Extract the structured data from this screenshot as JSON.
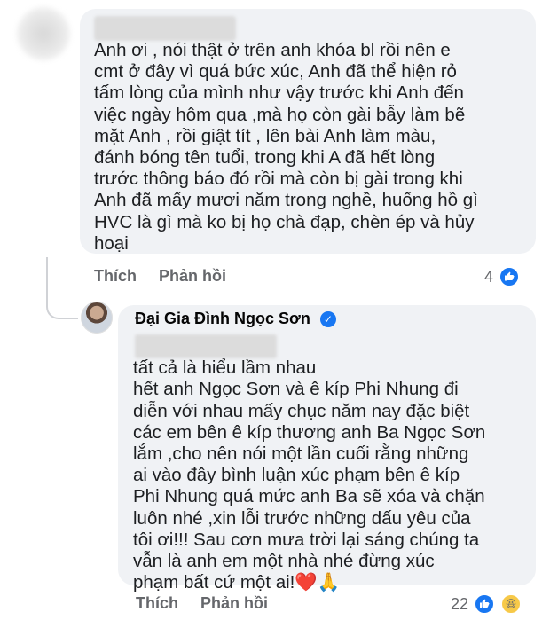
{
  "comment": {
    "text": "Anh ơi , nói thật ở trên anh khóa bl rồi nên e\ncmt ở đây vì quá bức xúc, Anh đã thể hiện rỏ\ntấm lòng của mình như vậy trước khi Anh đến\nviệc ngày hôm qua ,mà họ còn gài bẫy làm bẽ\nmặt Anh , rồi giật tít , lên bài Anh làm màu,\nđánh bóng tên tuổi, trong khi A đã hết lòng\ntrước thông báo đó rồi mà còn bị gài trong khi\nAnh đã mấy mươi năm trong nghề, huống hồ gì\nHVC  là gì mà ko bị họ chà đạp, chèn ép và hủy\nhoại",
    "actions": {
      "like": "Thích",
      "reply": "Phản hồi"
    },
    "reaction_count": "4"
  },
  "reply": {
    "author": "Đại Gia Đình Ngọc Sơn",
    "text": "                              tất cả là hiểu lầm nhau\nhết anh Ngọc Sơn và ê kíp Phi Nhung đi\ndiễn với nhau mấy chục năm nay đặc biệt\ncác em bên ê kíp thương anh Ba Ngọc Sơn\nlắm ,cho nên nói một lần cuối rằng những\nai vào đây bình luận xúc phạm bên ê kíp\nPhi Nhung quá mức anh Ba sẽ xóa và chặn\nluôn nhé ,xin lỗi trước những dấu yêu của\ntôi ơi!!! Sau cơn mưa trời lại sáng chúng ta\nvẫn là anh em một nhà nhé đừng xúc\nphạm bất cứ một ai!",
    "emoji": [
      "❤️",
      "🙏"
    ],
    "actions": {
      "like": "Thích",
      "reply": "Phản hồi"
    },
    "reaction_count": "22"
  },
  "icons": {
    "like": "like-icon",
    "haha": "haha-icon",
    "verified": "verified-badge-icon"
  },
  "colors": {
    "bubble": "#f0f2f5",
    "action_text": "#65676b",
    "fb_blue": "#1877f2"
  }
}
